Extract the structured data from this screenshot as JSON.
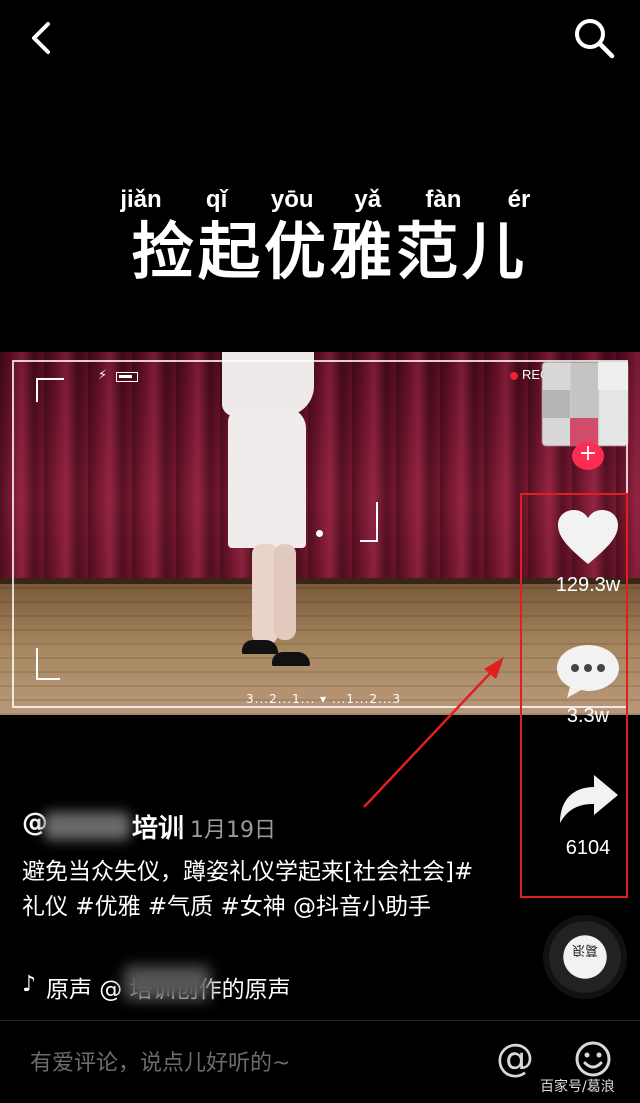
{
  "header": {
    "back_icon": "chevron-left-icon",
    "search_icon": "search-icon"
  },
  "video_title": {
    "pinyin": [
      "jiǎn",
      "qǐ",
      "yōu",
      "yǎ",
      "fàn",
      "ér"
    ],
    "text": "捡起优雅范儿"
  },
  "video_overlay": {
    "rec_label": "REC",
    "countdown": "3...2...1... ▾ ...1...2...3"
  },
  "actions": {
    "like_count": "129.3w",
    "comment_count": "3.3w",
    "share_count": "6104"
  },
  "post": {
    "author_prefix": "@",
    "author_suffix": "培训",
    "date": "· 1月19日",
    "description": "避免当众失仪，蹲姿礼仪学起来[社会社会]#礼仪 #优雅 #气质 #女神 @抖音小助手",
    "music_note": "♪",
    "music_text_start": "原声",
    "music_text_end": "  @              培训创作的原声"
  },
  "comment_bar": {
    "placeholder": "有爱评论，说点儿好听的~",
    "at_label": "@"
  },
  "disc": {
    "label": "葛浪"
  },
  "watermark": "百家号/葛浪",
  "colors": {
    "annotation_red": "#e02020",
    "accent_pink": "#fe2c55"
  }
}
